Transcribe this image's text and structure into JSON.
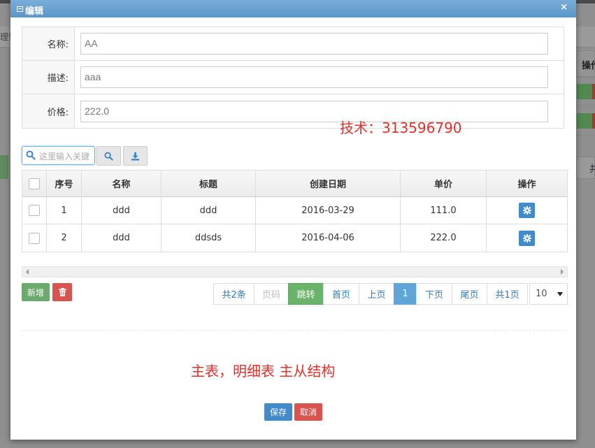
{
  "background": {
    "left_tab_text": "理管",
    "right_header_label": "操作",
    "right_pager_text": "共"
  },
  "dialog": {
    "title": "编辑",
    "close_glyph": "×"
  },
  "form": {
    "fields": [
      {
        "label": "名称:",
        "value": "AA"
      },
      {
        "label": "描述:",
        "value": "aaa"
      },
      {
        "label": "价格:",
        "value": "222.0"
      }
    ]
  },
  "annotations": {
    "tech": "技术：313596790",
    "structure": "主表，明细表  主从结构"
  },
  "toolbar": {
    "search_placeholder": "这里输入关键",
    "search_icon": "search-icon",
    "export_icon": "download-icon"
  },
  "grid": {
    "columns": [
      "",
      "序号",
      "名称",
      "标题",
      "创建日期",
      "单价",
      "操作"
    ],
    "rows": [
      {
        "seq": "1",
        "name": "ddd",
        "title": "ddd",
        "date": "2016-03-29",
        "price": "111.0"
      },
      {
        "seq": "2",
        "name": "ddd",
        "title": "ddsds",
        "date": "2016-04-06",
        "price": "222.0"
      }
    ]
  },
  "actions": {
    "add_label": "新增",
    "delete_icon": "trash-icon"
  },
  "pager": {
    "count": "共2条",
    "page_input_placeholder": "页码",
    "go": "跳转",
    "first": "首页",
    "prev": "上页",
    "current": "1",
    "next": "下页",
    "last": "尾页",
    "total_pages": "共1页",
    "page_size": "10"
  },
  "footer": {
    "save": "保存",
    "cancel": "取消"
  },
  "colors": {
    "header": "#5b95c8",
    "primary": "#428bca",
    "success": "#6aaa6a",
    "danger": "#d9534f",
    "annotation": "#e0322d"
  }
}
